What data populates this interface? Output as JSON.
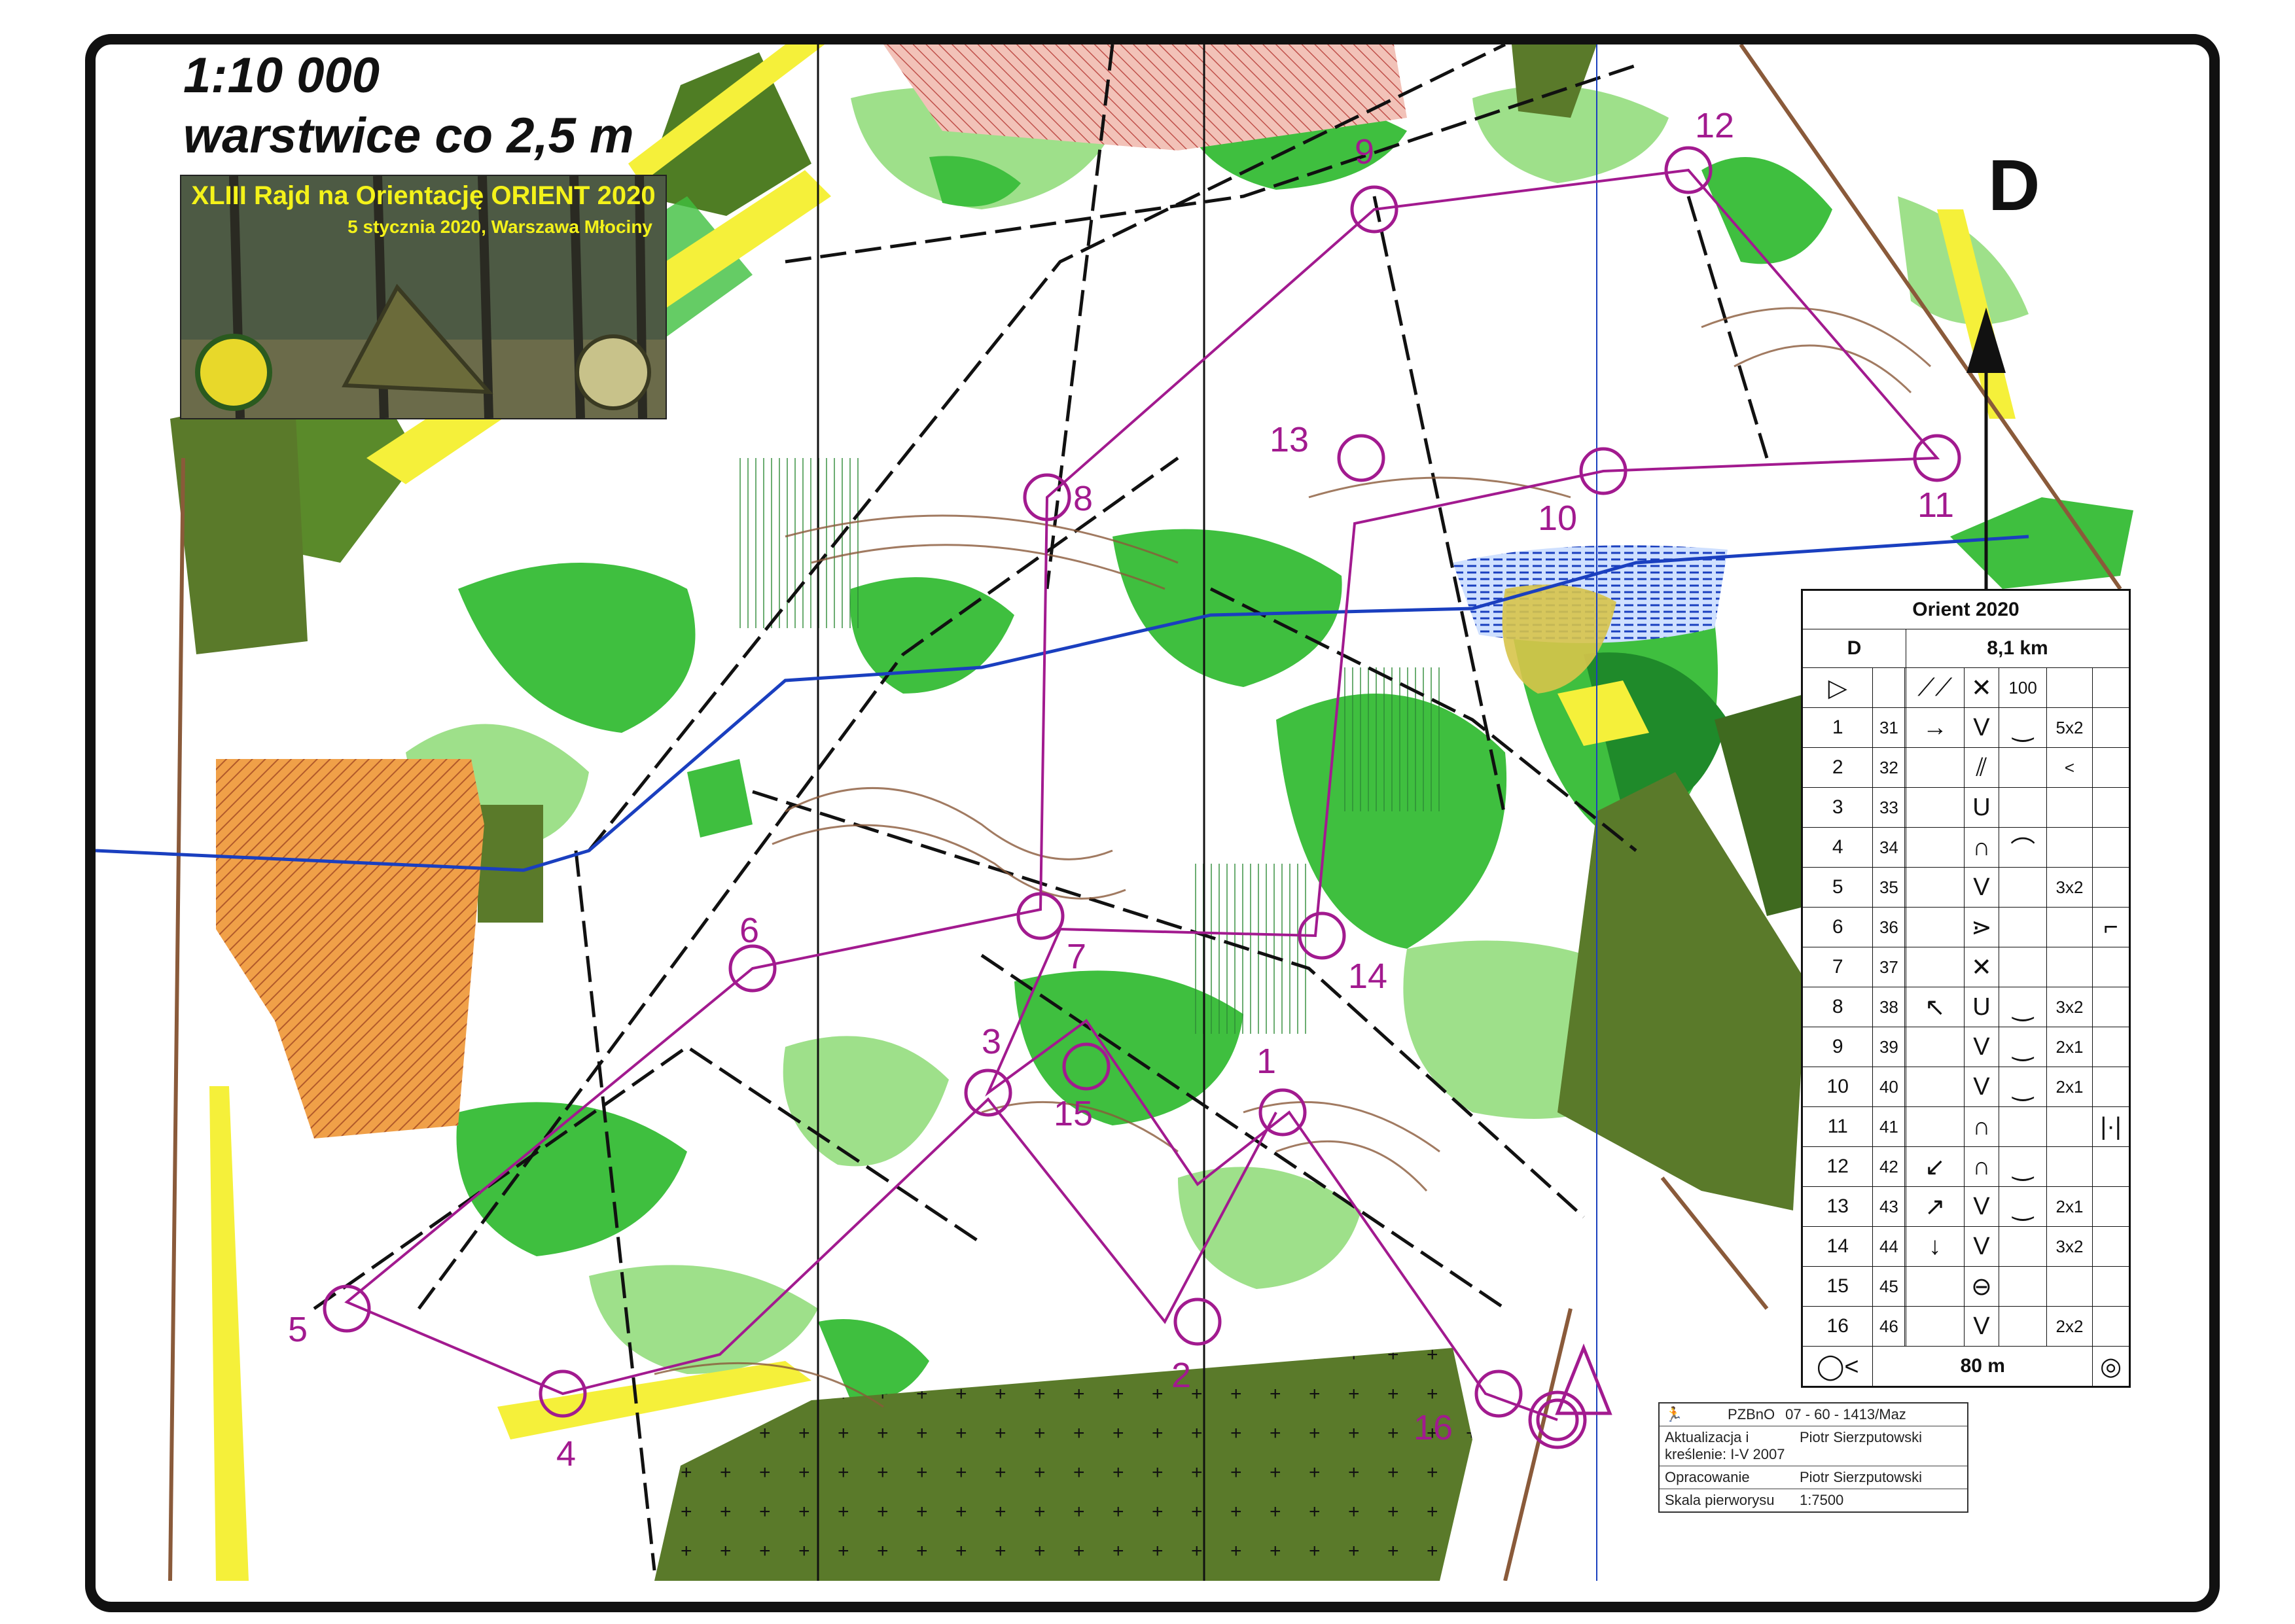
{
  "map": {
    "scale_line": "1:10 000",
    "contour_line": "warstwice co 2,5 m",
    "event_title": "XLIII Rajd na Orientację ORIENT 2020",
    "event_date": "5 stycznia 2020, Warszawa Młociny",
    "category_letter": "D",
    "colors": {
      "forest_green": "#3fbf3f",
      "light_green": "#9ee08a",
      "dark_green": "#1f8a2a",
      "olive": "#5a7a2a",
      "yellow": "#f5f03a",
      "brown": "#8a5a3a",
      "purple": "#a21a8f",
      "blue": "#1a3fbf"
    }
  },
  "controls": {
    "labels": [
      "1",
      "2",
      "3",
      "4",
      "5",
      "6",
      "7",
      "8",
      "9",
      "10",
      "11",
      "12",
      "13",
      "14",
      "15",
      "16"
    ]
  },
  "description_sheet": {
    "title": "Orient 2020",
    "class": "D",
    "length": "8,1 km",
    "start_row": {
      "col4": "⟋⟋",
      "col5": "✕",
      "col6": "100"
    },
    "rows": [
      {
        "n": "1",
        "code": "31",
        "dir": "→",
        "feat": "V",
        "appearance": "‿",
        "dim": "5x2",
        "loc": ""
      },
      {
        "n": "2",
        "code": "32",
        "dir": "",
        "feat": "⫽",
        "appearance": "",
        "dim": "<",
        "loc": ""
      },
      {
        "n": "3",
        "code": "33",
        "dir": "",
        "feat": "U",
        "appearance": "",
        "dim": "",
        "loc": ""
      },
      {
        "n": "4",
        "code": "34",
        "dir": "",
        "feat": "∩",
        "appearance": "⌒",
        "dim": "",
        "loc": ""
      },
      {
        "n": "5",
        "code": "35",
        "dir": "",
        "feat": "V",
        "appearance": "",
        "dim": "3x2",
        "loc": ""
      },
      {
        "n": "6",
        "code": "36",
        "dir": "",
        "feat": "⋗",
        "appearance": "",
        "dim": "",
        "loc": "⌐"
      },
      {
        "n": "7",
        "code": "37",
        "dir": "",
        "feat": "✕",
        "appearance": "",
        "dim": "",
        "loc": ""
      },
      {
        "n": "8",
        "code": "38",
        "dir": "↖",
        "feat": "U",
        "appearance": "‿",
        "dim": "3x2",
        "loc": ""
      },
      {
        "n": "9",
        "code": "39",
        "dir": "",
        "feat": "V",
        "appearance": "‿",
        "dim": "2x1",
        "loc": ""
      },
      {
        "n": "10",
        "code": "40",
        "dir": "",
        "feat": "V",
        "appearance": "‿",
        "dim": "2x1",
        "loc": ""
      },
      {
        "n": "11",
        "code": "41",
        "dir": "",
        "feat": "∩",
        "appearance": "",
        "dim": "",
        "loc": "|·|"
      },
      {
        "n": "12",
        "code": "42",
        "dir": "↙",
        "feat": "∩",
        "appearance": "‿",
        "dim": "",
        "loc": ""
      },
      {
        "n": "13",
        "code": "43",
        "dir": "↗",
        "feat": "V",
        "appearance": "‿",
        "dim": "2x1",
        "loc": ""
      },
      {
        "n": "14",
        "code": "44",
        "dir": "↓",
        "feat": "V",
        "appearance": "",
        "dim": "3x2",
        "loc": ""
      },
      {
        "n": "15",
        "code": "45",
        "dir": "",
        "feat": "⊖",
        "appearance": "",
        "dim": "",
        "loc": ""
      },
      {
        "n": "16",
        "code": "46",
        "dir": "",
        "feat": "V",
        "appearance": "",
        "dim": "2x2",
        "loc": ""
      }
    ],
    "finish_distance": "80 m"
  },
  "info_block": {
    "org": "PZBnO",
    "map_no": "07 - 60 - 1413/Maz",
    "update_label": "Aktualizacja i kreślenie: I-V 2007",
    "update_author": "Piotr Sierzputowski",
    "prep_label": "Opracowanie",
    "prep_author": "Piotr Sierzputowski",
    "scale_label": "Skala pierworysu",
    "scale_value": "1:7500"
  }
}
